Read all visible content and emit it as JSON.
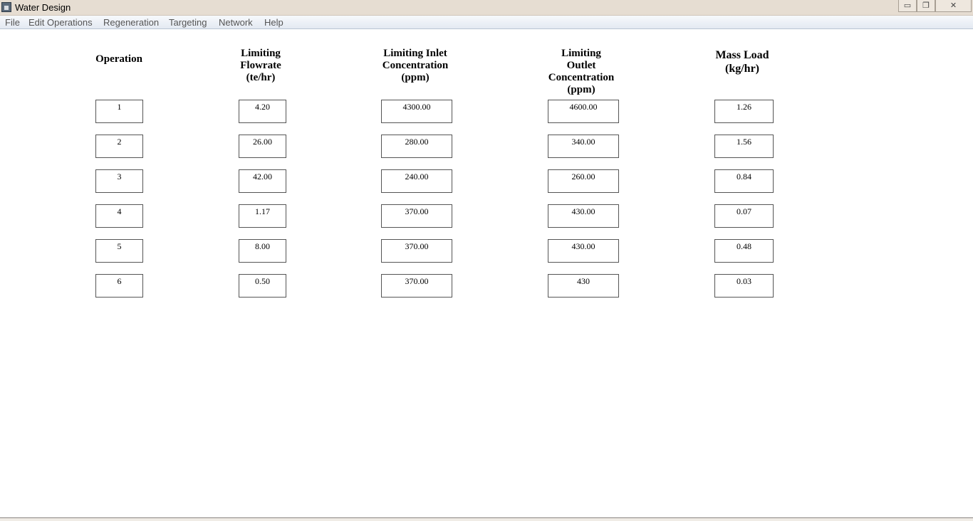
{
  "window": {
    "title": "Water Design",
    "minimize_glyph": "▭",
    "maximize_glyph": "❐",
    "close_glyph": "✕"
  },
  "menu": {
    "items": [
      {
        "label": "File"
      },
      {
        "label": "Edit Operations"
      },
      {
        "label": "Regeneration"
      },
      {
        "label": "Targeting"
      },
      {
        "label": "Network"
      },
      {
        "label": "Help"
      }
    ]
  },
  "table": {
    "headers": [
      {
        "lines": [
          "Operation"
        ]
      },
      {
        "lines": [
          "Limiting",
          "Flowrate",
          "(te/hr)"
        ]
      },
      {
        "lines": [
          "Limiting Inlet",
          "Concentration",
          "(ppm)"
        ]
      },
      {
        "lines": [
          "Limiting",
          "Outlet",
          "Concentration",
          "(ppm)"
        ]
      },
      {
        "lines": [
          "Mass Load",
          "(kg/hr)"
        ]
      }
    ],
    "rows": [
      [
        "1",
        "4.20",
        "4300.00",
        "4600.00",
        "1.26"
      ],
      [
        "2",
        "26.00",
        "280.00",
        "340.00",
        "1.56"
      ],
      [
        "3",
        "42.00",
        "240.00",
        "260.00",
        "0.84"
      ],
      [
        "4",
        "1.17",
        "370.00",
        "430.00",
        "0.07"
      ],
      [
        "5",
        "8.00",
        "370.00",
        "430.00",
        "0.48"
      ],
      [
        "6",
        "0.50",
        "370.00",
        "430",
        "0.03"
      ]
    ]
  }
}
